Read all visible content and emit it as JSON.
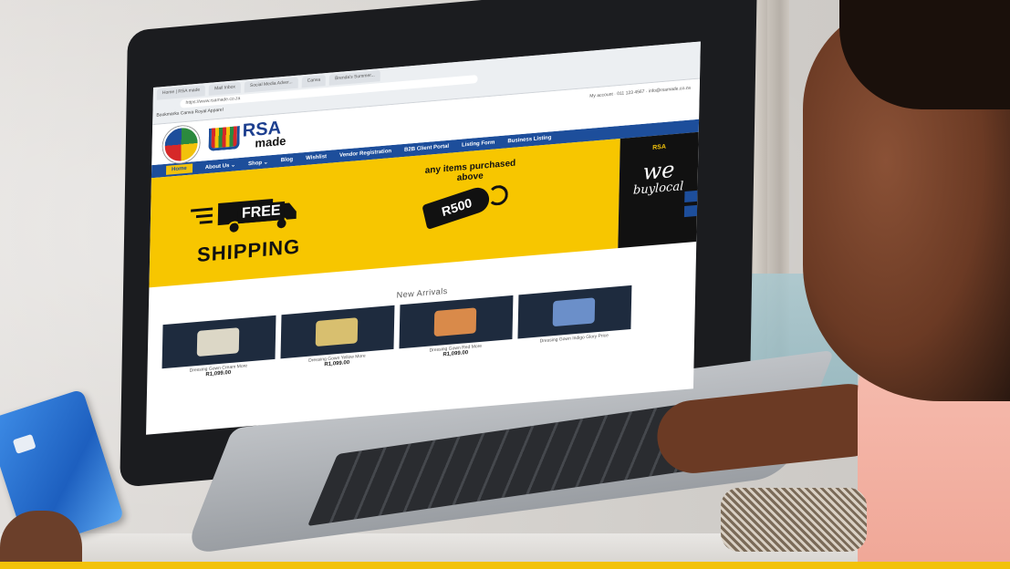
{
  "browser": {
    "tabs": [
      "Home | RSA made",
      "Mail Inbox",
      "Social Media Adver...",
      "Canva",
      "Brenda's Summer..."
    ],
    "url": "https://www.rsamade.co.za",
    "bookmarks": "Bookmarks  Canva  Royal Apparel"
  },
  "site": {
    "brand": {
      "rsa": "RSA",
      "made": "made"
    },
    "top_links": "My account  ·  011 123 4567  ·  info@rsamade.co.za",
    "nav": [
      {
        "label": "Home",
        "active": true
      },
      {
        "label": "About Us ⌄"
      },
      {
        "label": "Shop ⌄"
      },
      {
        "label": "Blog"
      },
      {
        "label": "Wishlist"
      },
      {
        "label": "Vendor Registration"
      },
      {
        "label": "B2B Client Portal"
      },
      {
        "label": "Listing Form"
      },
      {
        "label": "Business Listing"
      }
    ],
    "banner": {
      "free": "FREE",
      "shipping": "SHIPPING",
      "promo": "any items purchased above",
      "amount": "R500",
      "we": "we",
      "buy_local": "buylocal"
    },
    "arrivals_title": "New Arrivals",
    "products": [
      {
        "name": "Dressing Gown Cream More",
        "price": "R1,099.00",
        "color": "#dcd7c6"
      },
      {
        "name": "Dressing Gown Yellow More",
        "price": "R1,099.00",
        "color": "#d8bf6f"
      },
      {
        "name": "Dressing Gown Red More",
        "price": "R1,099.00",
        "color": "#d98a4a"
      },
      {
        "name": "Dressing Gown Indigo Glory Price",
        "price": "",
        "color": "#6b8fc9"
      }
    ]
  },
  "colors": {
    "brand_blue": "#1d4e9b",
    "brand_yellow": "#f7c600",
    "brand_red": "#d62828",
    "brand_green": "#2b8a3e"
  }
}
